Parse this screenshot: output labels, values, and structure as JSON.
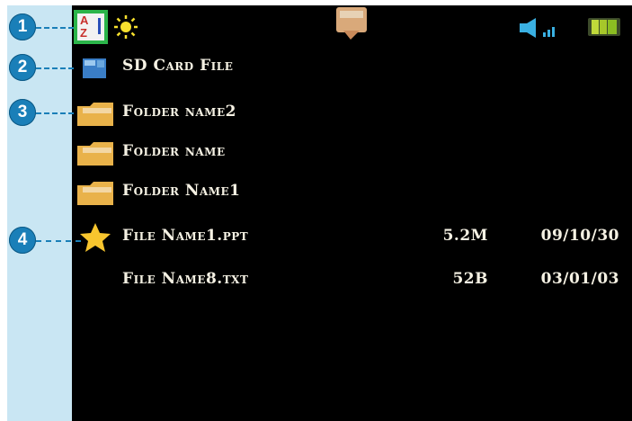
{
  "callouts": [
    "1",
    "2",
    "3",
    "4"
  ],
  "status_bar": {
    "sort_icon": "sort-az-icon",
    "sort_text": "A Z",
    "brightness_icon": "sun-icon",
    "center_icon": "folder-hand-icon",
    "volume_icon": "speaker-signal-icon",
    "battery_icon": "battery-icon",
    "accent": "#2bb54a"
  },
  "sd_card": {
    "label": "SD Card File",
    "icon": "sd-card-icon"
  },
  "folders": [
    {
      "name": "Folder name2",
      "icon": "folder-icon"
    },
    {
      "name": "Folder name",
      "icon": "folder-icon"
    },
    {
      "name": "Folder Name1",
      "icon": "folder-icon"
    }
  ],
  "files": [
    {
      "name": "File Name1.ppt",
      "size": "5.2M",
      "date": "09/10/30",
      "icon": "star-icon"
    },
    {
      "name": "File Name8.txt",
      "size": "52B",
      "date": "03/01/03",
      "icon": ""
    }
  ],
  "colors": {
    "callout": "#1a7fb8",
    "sidebar": "#c9e6f3",
    "screen": "#000000",
    "text": "#f5f1e3",
    "folder": "#e9b24a",
    "star": "#f7c52e"
  }
}
